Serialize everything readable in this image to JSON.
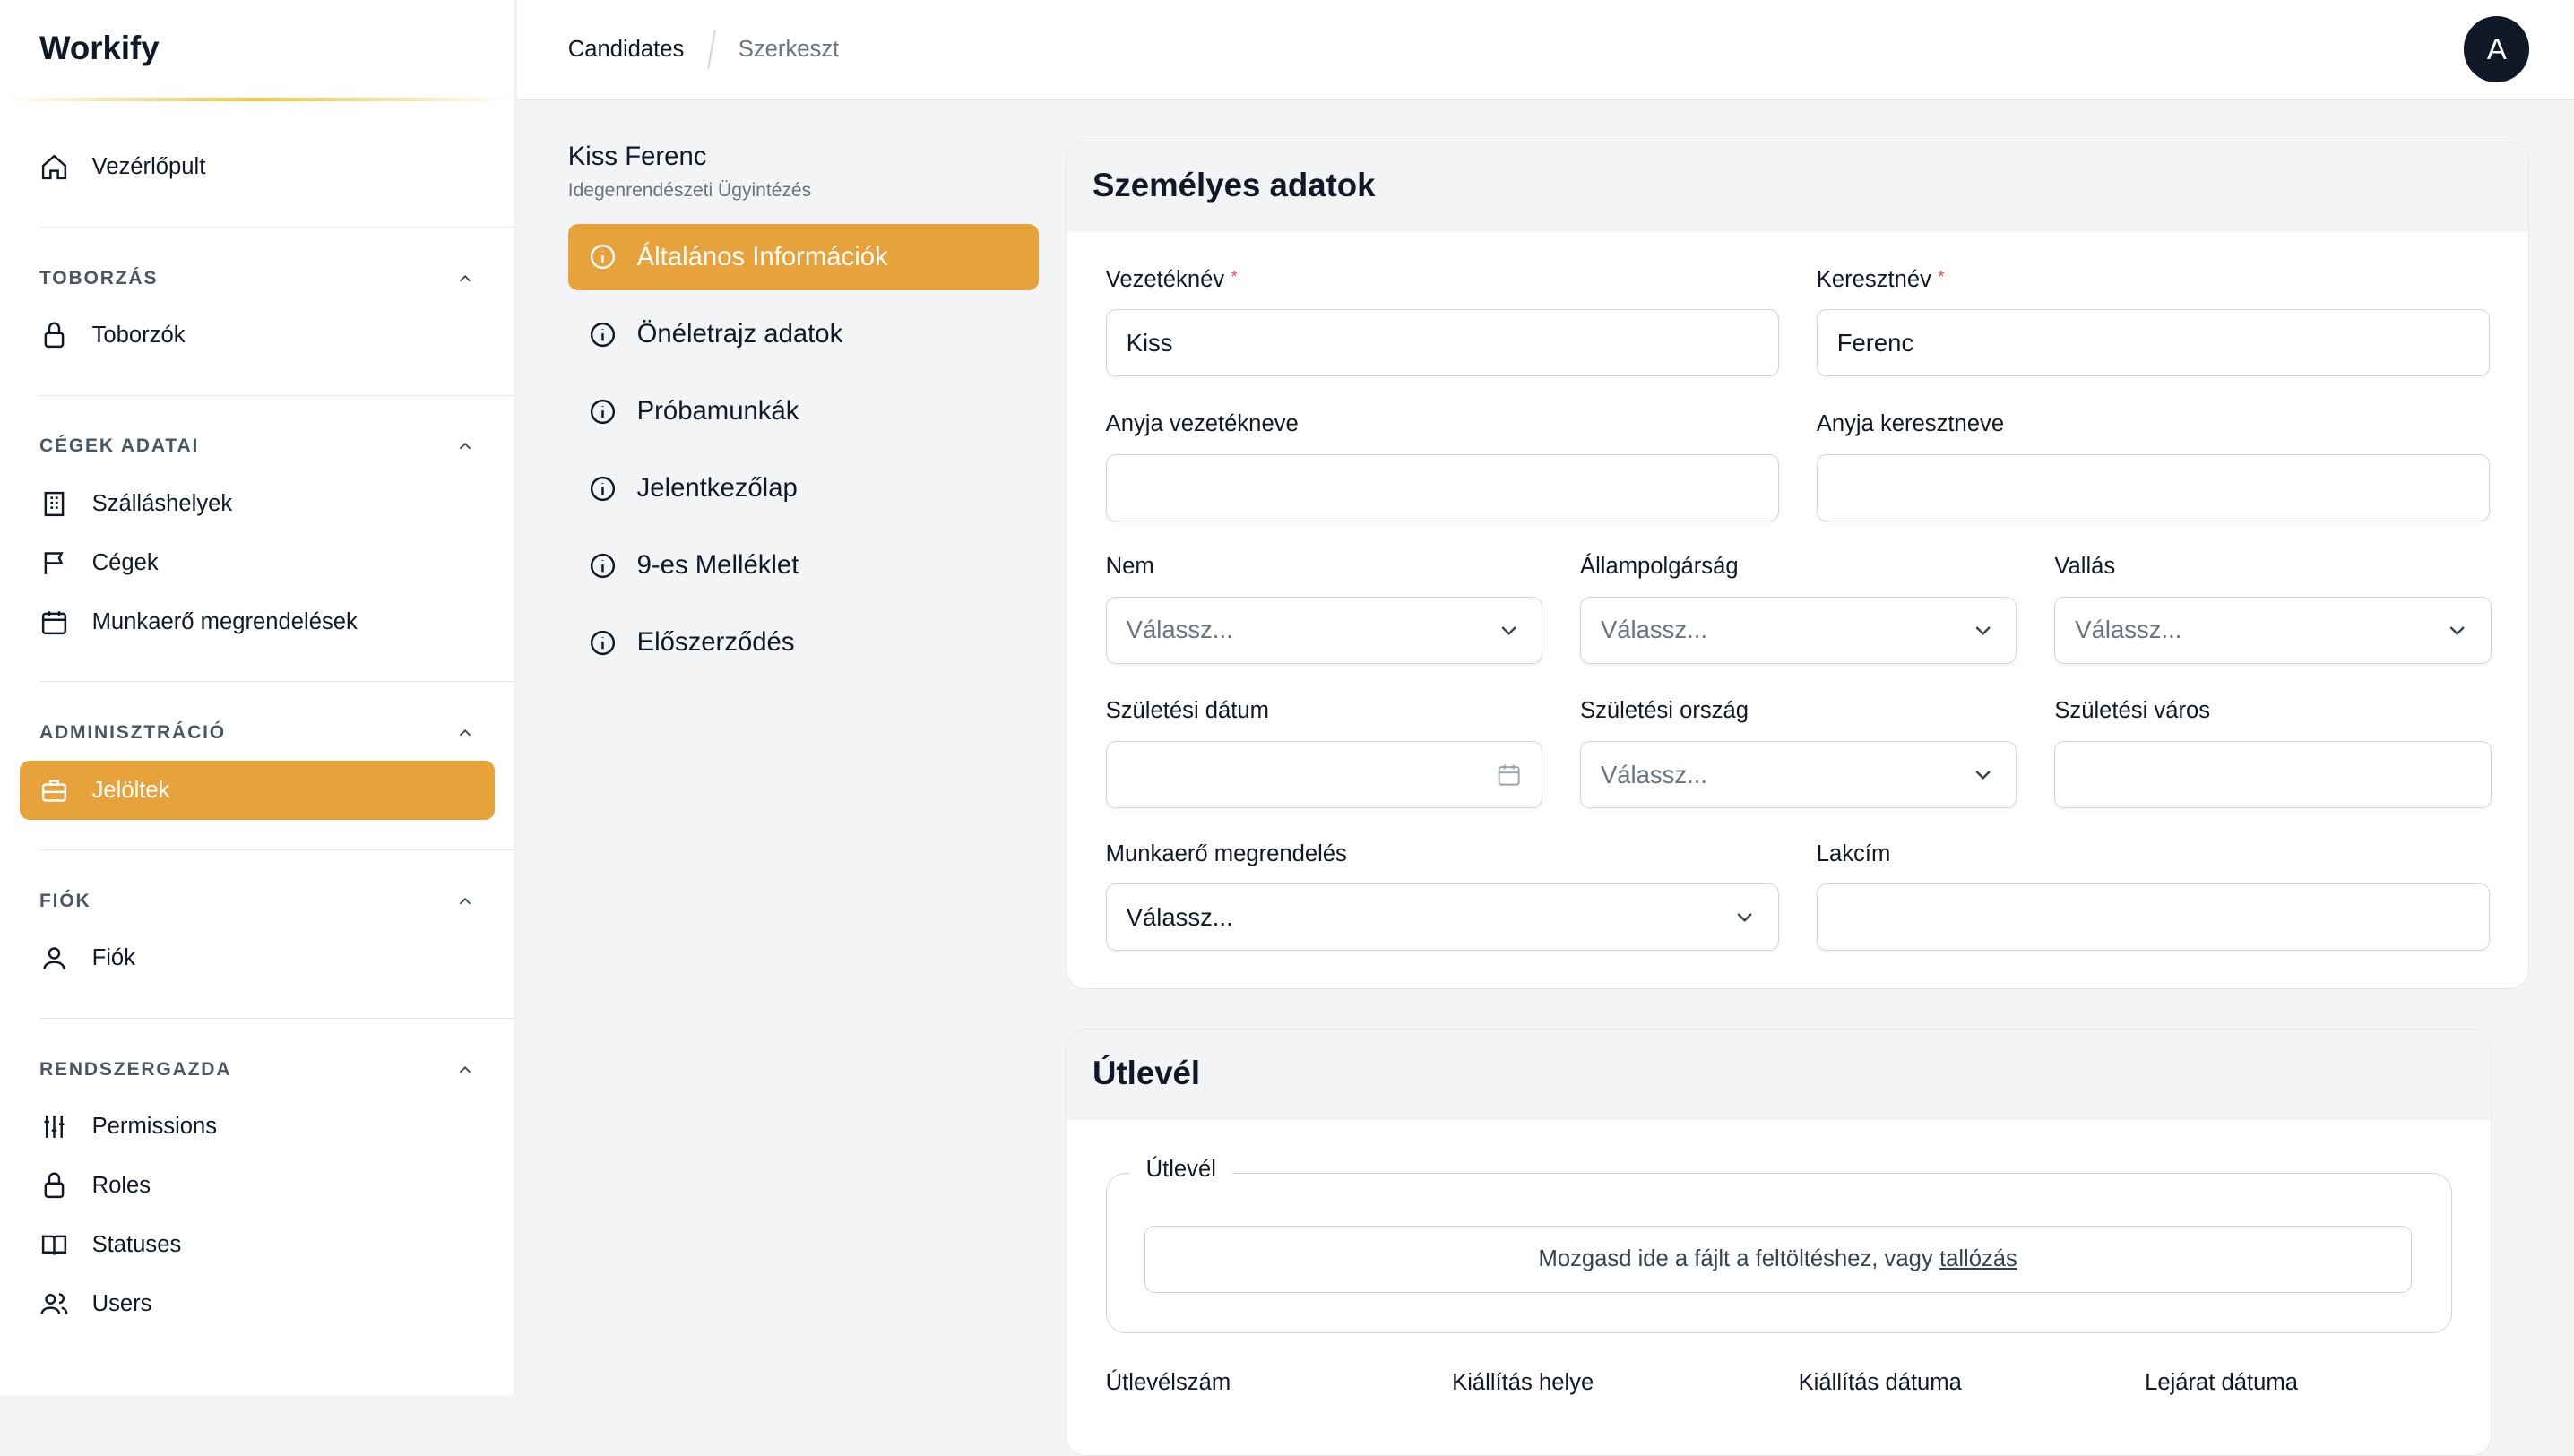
{
  "app": {
    "name": "Workify"
  },
  "breadcrumb": [
    "Candidates",
    "Szerkeszt"
  ],
  "user": {
    "avatar_letter": "A"
  },
  "sidebar": {
    "top": {
      "label": "Vezérlőpult"
    },
    "sections": [
      {
        "title": "TOBORZÁS",
        "items": [
          "Toborzók"
        ]
      },
      {
        "title": "CÉGEK ADATAI",
        "items": [
          "Szálláshelyek",
          "Cégek",
          "Munkaerő megrendelések"
        ]
      },
      {
        "title": "ADMINISZTRÁCIÓ",
        "items": [
          "Jelöltek"
        ]
      },
      {
        "title": "FIÓK",
        "items": [
          "Fiók"
        ]
      },
      {
        "title": "RENDSZERGAZDA",
        "items": [
          "Permissions",
          "Roles",
          "Statuses",
          "Users"
        ]
      }
    ]
  },
  "candidate": {
    "name": "Kiss Ferenc",
    "subtitle": "Idegenrendészeti Ügyintézés"
  },
  "tabs": [
    "Általános Információk",
    "Önéletrajz adatok",
    "Próbamunkák",
    "Jelentkezőlap",
    "9-es Melléklet",
    "Előszerződés"
  ],
  "personal": {
    "title": "Személyes adatok",
    "last_name": {
      "label": "Vezetéknév",
      "value": "Kiss"
    },
    "first_name": {
      "label": "Keresztnév",
      "value": "Ferenc"
    },
    "mother_last": {
      "label": "Anyja vezetékneve",
      "value": ""
    },
    "mother_first": {
      "label": "Anyja keresztneve",
      "value": ""
    },
    "gender": {
      "label": "Nem",
      "placeholder": "Válassz..."
    },
    "citizenship": {
      "label": "Állampolgárság",
      "placeholder": "Válassz..."
    },
    "religion": {
      "label": "Vallás",
      "placeholder": "Válassz..."
    },
    "birth_date": {
      "label": "Születési dátum",
      "value": ""
    },
    "birth_country": {
      "label": "Születési ország",
      "placeholder": "Válassz..."
    },
    "birth_city": {
      "label": "Születési város",
      "value": ""
    },
    "order": {
      "label": "Munkaerő megrendelés",
      "placeholder": "Válassz..."
    },
    "address": {
      "label": "Lakcím",
      "value": ""
    }
  },
  "passport": {
    "title": "Útlevél",
    "upload_legend": "Útlevél",
    "drop_text": "Mozgasd ide a fájlt a feltöltéshez, vagy",
    "browse": "tallózás",
    "fields": [
      "Útlevélszám",
      "Kiállítás helye",
      "Kiállítás dátuma",
      "Lejárat dátuma"
    ]
  }
}
